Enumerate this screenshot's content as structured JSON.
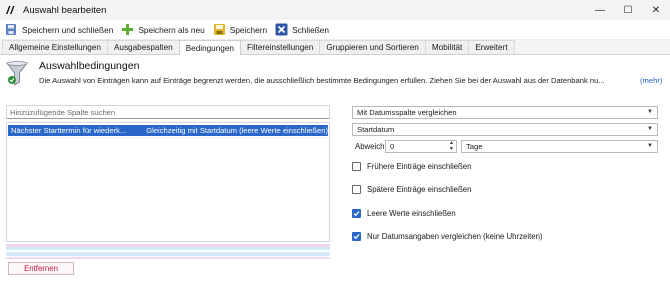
{
  "window": {
    "title": "Auswahl bearbeiten",
    "controls": {
      "minimize": "—",
      "maximize": "☐",
      "close": "✕"
    }
  },
  "toolbar": {
    "items": [
      {
        "label": "Speichern und schließen",
        "icon": "save-close-icon"
      },
      {
        "label": "Speichern als neu",
        "icon": "add-icon"
      },
      {
        "label": "Speichern",
        "icon": "save-icon"
      },
      {
        "label": "Schließen",
        "icon": "close-icon"
      }
    ]
  },
  "tabs": [
    {
      "label": "Allgemeine Einstellungen",
      "active": false
    },
    {
      "label": "Ausgabespalten",
      "active": false
    },
    {
      "label": "Bedingungen",
      "active": true
    },
    {
      "label": "Filtereinstellungen",
      "active": false
    },
    {
      "label": "Gruppieren und Sortieren",
      "active": false
    },
    {
      "label": "Mobilität",
      "active": false
    },
    {
      "label": "Erweitert",
      "active": false
    }
  ],
  "header": {
    "title": "Auswahlbedingungen",
    "description": "Die Auswahl von Einträgen kann auf Einträge begrenzt werden, die ausschließlich bestimmte Bedingungen erfüllen. Ziehen Sie bei der Auswahl aus der Datenbank nu...",
    "more_link": "(mehr)"
  },
  "left": {
    "search_placeholder": "Hinzuzufügende Spalte suchen",
    "rows": [
      {
        "column": "Nächster Starttermin für wiederk...",
        "condition": "Gleichzeitig mit Startdatum (leere Werte einschließen)",
        "selected": true
      }
    ],
    "remove_button": "Entfernen"
  },
  "right": {
    "mode_select": "Mit Datumsspalte vergleichen",
    "column_select": "Startdatum",
    "deviation_label": "Abweichung",
    "deviation_value": "0",
    "unit_select": "Tage",
    "checkboxes": [
      {
        "label": "Frühere Einträge einschließen",
        "checked": false
      },
      {
        "label": "Spätere Einträge einschließen",
        "checked": false
      },
      {
        "label": "Leere Werte einschließen",
        "checked": true
      },
      {
        "label": "Nur Datumsangaben vergleichen (keine Uhrzeiten)",
        "checked": true
      }
    ]
  },
  "colors": {
    "accent": "#2a67c9",
    "remove_text": "#c0143c",
    "link": "#1f5fbf"
  }
}
